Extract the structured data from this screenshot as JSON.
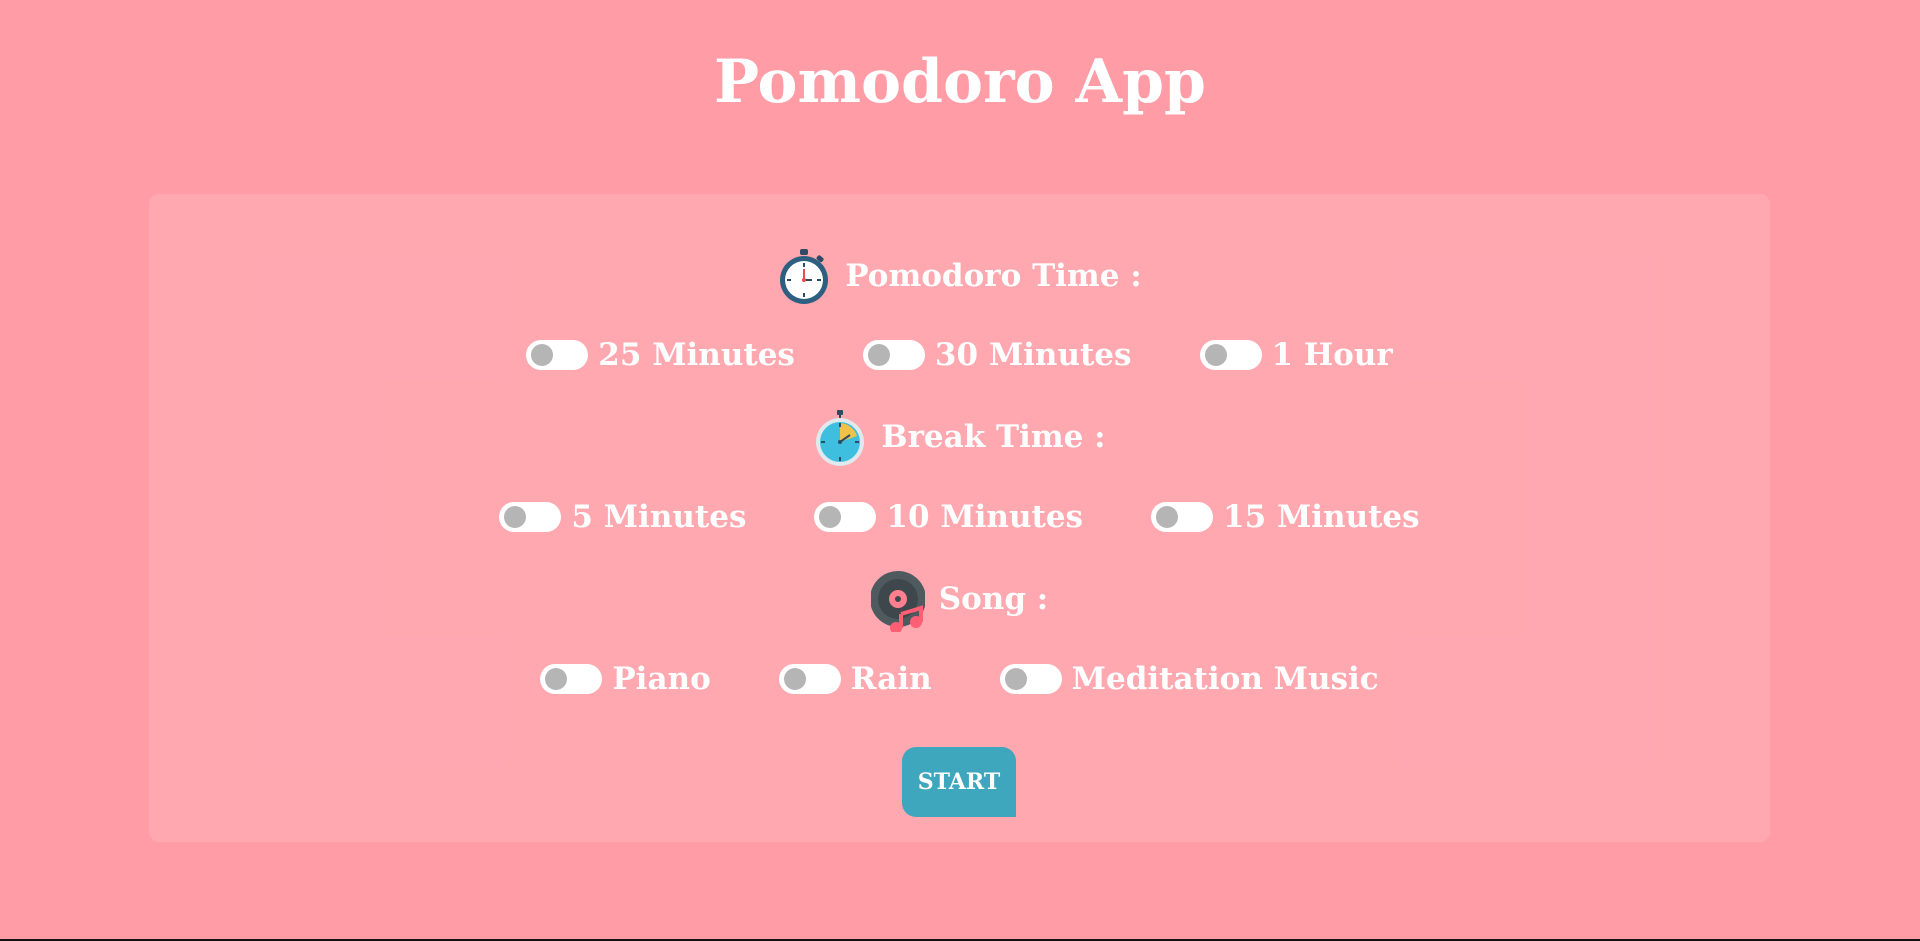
{
  "app": {
    "title": "Pomodoro App"
  },
  "colors": {
    "background": "#ff9ca6",
    "panel": "#ffa6ae",
    "accent_button": "#3ea6bd",
    "toggle_track": "#ffffff",
    "toggle_knob": "#b5b5b5"
  },
  "sections": {
    "pomodoro": {
      "icon": "stopwatch-icon",
      "label": "Pomodoro Time :",
      "options": [
        {
          "label": "25 Minutes",
          "checked": false
        },
        {
          "label": "30 Minutes",
          "checked": false
        },
        {
          "label": "1 Hour",
          "checked": false
        }
      ]
    },
    "break": {
      "icon": "timer-icon",
      "label": "Break Time :",
      "options": [
        {
          "label": "5 Minutes",
          "checked": false
        },
        {
          "label": "10 Minutes",
          "checked": false
        },
        {
          "label": "15 Minutes",
          "checked": false
        }
      ]
    },
    "song": {
      "icon": "vinyl-music-icon",
      "label": "Song :",
      "options": [
        {
          "label": "Piano",
          "checked": false
        },
        {
          "label": "Rain",
          "checked": false
        },
        {
          "label": "Meditation Music",
          "checked": false
        }
      ]
    }
  },
  "start_button": {
    "label": "START"
  }
}
